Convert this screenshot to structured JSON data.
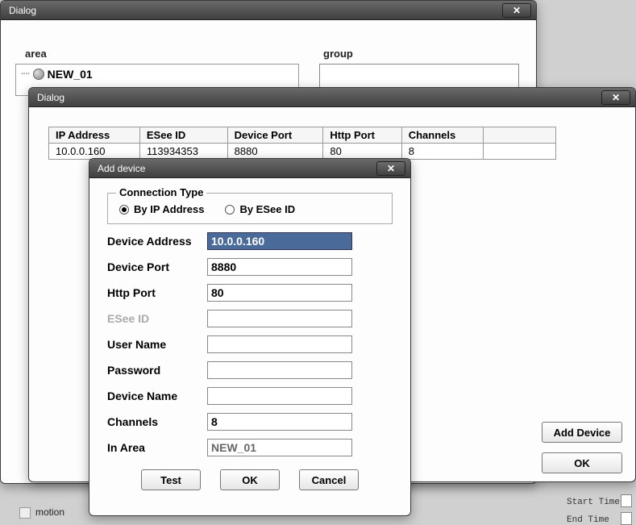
{
  "dialog1": {
    "title": "Dialog",
    "area_label": "area",
    "group_label": "group",
    "tree_item": "NEW_01"
  },
  "dialog2": {
    "title": "Dialog",
    "columns": [
      "IP Address",
      "ESee ID",
      "Device Port",
      "Http Port",
      "Channels"
    ],
    "row": {
      "ip": "10.0.0.160",
      "esee": "113934353",
      "devport": "8880",
      "httpport": "80",
      "channels": "8"
    },
    "add_device_btn": "Add Device",
    "ok_btn": "OK"
  },
  "add": {
    "title": "Add device",
    "conn_legend": "Connection Type",
    "radio_ip": "By IP Address",
    "radio_esee": "By ESee ID",
    "labels": {
      "device_address": "Device Address",
      "device_port": "Device Port",
      "http_port": "Http Port",
      "esee_id": "ESee ID",
      "user_name": "User Name",
      "password": "Password",
      "device_name": "Device Name",
      "channels": "Channels",
      "in_area": "In Area"
    },
    "values": {
      "device_address": "10.0.0.160",
      "device_port": "8880",
      "http_port": "80",
      "esee_id": "",
      "user_name": "",
      "password": "",
      "device_name": "",
      "channels": "8",
      "in_area": "NEW_01"
    },
    "buttons": {
      "test": "Test",
      "ok": "OK",
      "cancel": "Cancel"
    }
  },
  "bg": {
    "motion": "motion",
    "start_time": "Start Time",
    "end_time": "End   Time"
  }
}
